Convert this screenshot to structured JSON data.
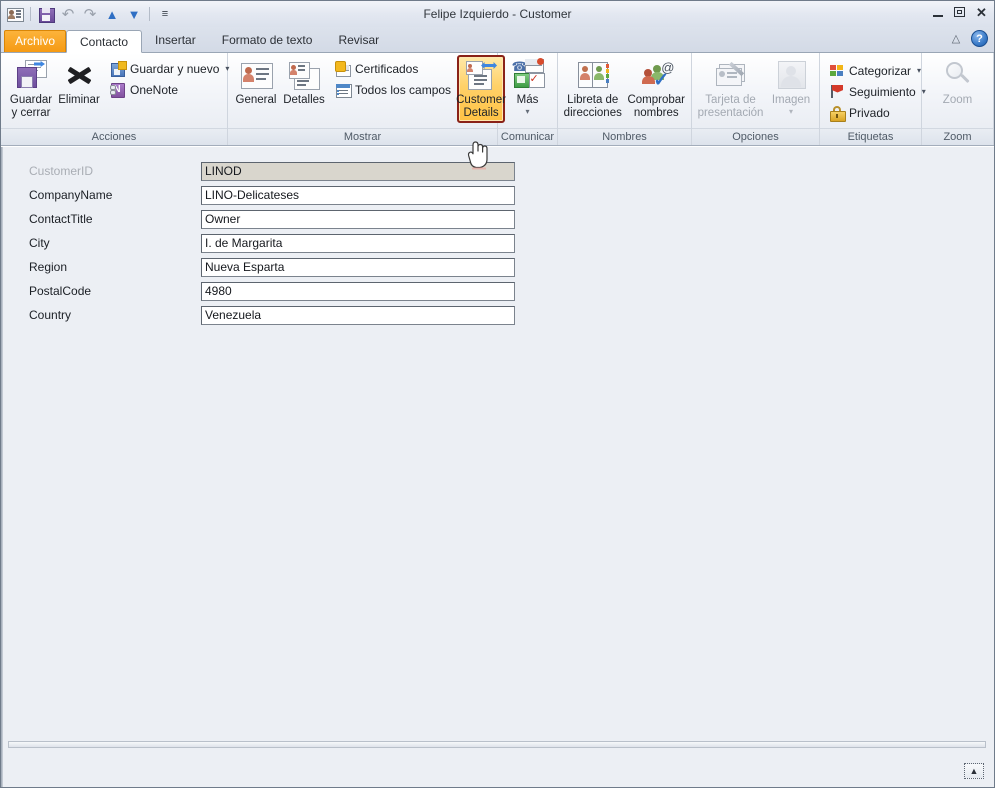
{
  "window": {
    "title": "Felipe Izquierdo - Customer",
    "controls": {
      "minimize": "–",
      "maximize": "❐",
      "close": "✕"
    }
  },
  "quick_access": {
    "items": [
      {
        "name": "contact-card-icon",
        "label": ""
      },
      {
        "name": "save-icon",
        "label": ""
      },
      {
        "name": "undo-icon",
        "label": ""
      },
      {
        "name": "redo-icon",
        "label": ""
      },
      {
        "name": "previous-item-icon",
        "label": ""
      },
      {
        "name": "next-item-icon",
        "label": ""
      },
      {
        "name": "customize-qat-icon",
        "label": ""
      }
    ]
  },
  "tabs": {
    "file_label": "Archivo",
    "items": [
      {
        "label": "Contacto",
        "active": true
      },
      {
        "label": "Insertar",
        "active": false
      },
      {
        "label": "Formato de texto",
        "active": false
      },
      {
        "label": "Revisar",
        "active": false
      }
    ],
    "collapse_ribbon": "△",
    "help": "?"
  },
  "ribbon": {
    "groups": [
      {
        "name": "acciones",
        "label": "Acciones",
        "big_buttons": [
          {
            "label": "Guardar\ny cerrar",
            "icon": "save-and-close-icon"
          },
          {
            "label": "Eliminar",
            "icon": "delete-icon"
          }
        ],
        "small_buttons": [
          {
            "label": "Guardar y nuevo",
            "icon": "save-and-new-icon",
            "caret": "▾"
          },
          {
            "label": "OneNote",
            "icon": "onenote-icon",
            "caret": ""
          }
        ]
      },
      {
        "name": "mostrar",
        "label": "Mostrar",
        "big_buttons": [
          {
            "label": "General",
            "icon": "general-view-icon"
          },
          {
            "label": "Detalles",
            "icon": "details-view-icon"
          }
        ],
        "small_buttons": [
          {
            "label": "Certificados",
            "icon": "certificates-icon",
            "caret": ""
          },
          {
            "label": "Todos los campos",
            "icon": "all-fields-icon",
            "caret": ""
          }
        ],
        "highlighted_button": {
          "label": "Customer\nDetails",
          "icon": "customer-details-icon",
          "state": "hovered"
        }
      },
      {
        "name": "comunicar",
        "label": "Comunicar",
        "big_buttons": [
          {
            "label": "Más",
            "icon": "more-communicate-icon",
            "caret": "▾"
          }
        ]
      },
      {
        "name": "nombres",
        "label": "Nombres",
        "big_buttons": [
          {
            "label": "Libreta de\ndirecciones",
            "icon": "address-book-icon"
          },
          {
            "label": "Comprobar\nnombres",
            "icon": "check-names-icon"
          }
        ]
      },
      {
        "name": "opciones",
        "label": "Opciones",
        "big_buttons": [
          {
            "label": "Tarjeta de\npresentación",
            "icon": "business-card-icon",
            "disabled": true
          },
          {
            "label": "Imagen",
            "icon": "picture-icon",
            "disabled": true,
            "caret": "▾"
          }
        ]
      },
      {
        "name": "etiquetas",
        "label": "Etiquetas",
        "small_buttons": [
          {
            "label": "Categorizar",
            "icon": "categorize-icon",
            "caret": "▾"
          },
          {
            "label": "Seguimiento",
            "icon": "follow-up-flag-icon",
            "caret": "▾"
          },
          {
            "label": "Privado",
            "icon": "private-lock-icon",
            "caret": ""
          }
        ]
      },
      {
        "name": "zoom",
        "label": "Zoom",
        "big_buttons": [
          {
            "label": "Zoom",
            "icon": "zoom-magnifier-icon",
            "disabled": true
          }
        ]
      }
    ]
  },
  "form": {
    "fields": [
      {
        "label": "CustomerID",
        "value": "LINOD",
        "readonly": true
      },
      {
        "label": "CompanyName",
        "value": "LINO-Delicateses",
        "readonly": false
      },
      {
        "label": "ContactTitle",
        "value": "Owner",
        "readonly": false
      },
      {
        "label": "City",
        "value": "I. de Margarita",
        "readonly": false
      },
      {
        "label": "Region",
        "value": "Nueva Esparta",
        "readonly": false
      },
      {
        "label": "PostalCode",
        "value": "4980",
        "readonly": false
      },
      {
        "label": "Country",
        "value": "Venezuela",
        "readonly": false
      }
    ]
  },
  "footer": {
    "collapse_label": "▲"
  },
  "colors": {
    "accent_orange": "#f59a13",
    "highlight_border": "#8a2218",
    "highlight_fill": "#ffd169",
    "window_border": "#6f7b8a",
    "body_bg": "#eceff4",
    "readonly_field_bg": "#d9d6cd"
  }
}
